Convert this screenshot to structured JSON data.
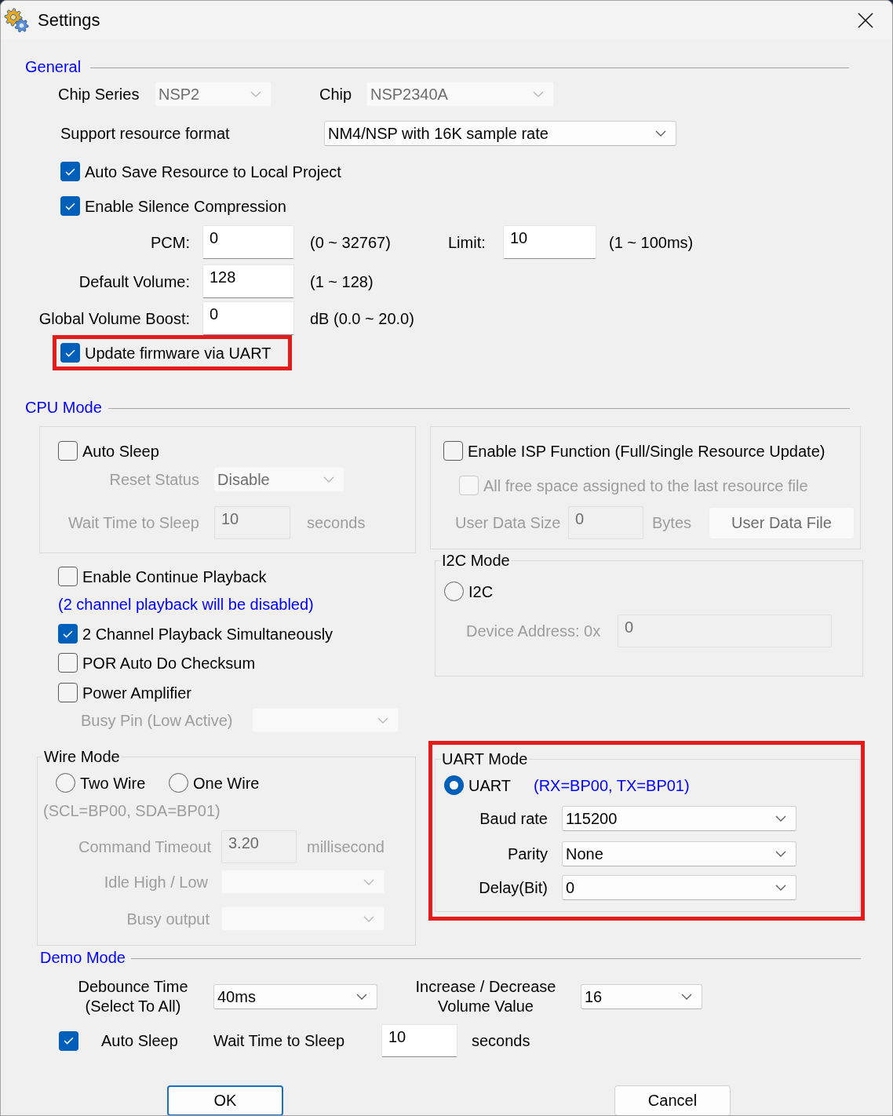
{
  "window": {
    "title": "Settings"
  },
  "general": {
    "heading": "General",
    "chip_series": {
      "label": "Chip Series",
      "value": "NSP2",
      "disabled": true
    },
    "chip": {
      "label": "Chip",
      "value": "NSP2340A",
      "disabled": true
    },
    "resource_format": {
      "label": "Support resource format",
      "value": "NM4/NSP with 16K sample rate",
      "disabled": false
    },
    "options": [
      {
        "label": "Auto Save Resource to Local Project",
        "checked": true
      },
      {
        "label": "Enable Silence Compression",
        "checked": true
      }
    ],
    "pcm": {
      "label": "PCM:",
      "value": "0",
      "range": "(0 ~ 32767)"
    },
    "limit": {
      "label": "Limit:",
      "value": "10",
      "range": "(1 ~ 100ms)"
    },
    "default_volume": {
      "label": "Default Volume:",
      "value": "128",
      "range": "(1 ~ 128)"
    },
    "global_volume_boost": {
      "label": "Global Volume Boost:",
      "value": "0",
      "range": "dB (0.0 ~ 20.0)"
    },
    "update_firmware": {
      "label": "Update firmware via UART",
      "checked": true,
      "highlighted": true
    }
  },
  "cpu_mode": {
    "heading": "CPU Mode",
    "sleep_group": {
      "auto_sleep": {
        "label": "Auto Sleep",
        "checked": false
      },
      "reset_status": {
        "label": "Reset Status",
        "value": "Disable",
        "disabled": true
      },
      "wait_time": {
        "label": "Wait Time to Sleep",
        "value": "10",
        "unit": "seconds",
        "disabled": true
      }
    },
    "playback_options": [
      {
        "kind": "checkbox",
        "label": "Enable Continue Playback",
        "checked": false
      },
      {
        "kind": "note",
        "text": "(2 channel playback will be disabled)"
      },
      {
        "kind": "checkbox",
        "label": "2 Channel Playback Simultaneously",
        "checked": true
      },
      {
        "kind": "checkbox",
        "label": "POR Auto Do Checksum",
        "checked": false
      },
      {
        "kind": "checkbox",
        "label": "Power Amplifier",
        "checked": false
      }
    ],
    "busy_pin": {
      "label": "Busy Pin (Low Active)",
      "disabled": true
    },
    "wire_mode": {
      "legend": "Wire Mode",
      "options": [
        {
          "label": "Two Wire",
          "selected": false
        },
        {
          "label": "One Wire",
          "selected": false
        }
      ],
      "pins": {
        "text": "(SCL=BP00, SDA=BP01)",
        "disabled": true
      },
      "command_timeout": {
        "label": "Command Timeout",
        "value": "3.20",
        "unit": "millisecond",
        "disabled": true
      },
      "idle_level": {
        "label": "Idle High / Low",
        "disabled": true
      },
      "busy_output": {
        "label": "Busy output",
        "disabled": true
      }
    },
    "isp_group": {
      "enable_isp": {
        "label": "Enable ISP Function (Full/Single Resource Update)",
        "checked": false
      },
      "all_free_space": {
        "label": "All free space assigned to the last resource file",
        "checked": false,
        "disabled": true
      },
      "user_data_size": {
        "label": "User Data Size",
        "value": "0",
        "unit": "Bytes",
        "disabled": true
      },
      "user_data_file": {
        "label": "User Data File",
        "disabled": true
      }
    },
    "i2c_mode": {
      "legend": "I2C Mode",
      "option": {
        "label": "I2C",
        "selected": false
      },
      "device_address": {
        "label": "Device Address: 0x",
        "value": "0",
        "disabled": true
      }
    },
    "uart_mode": {
      "legend": "UART Mode",
      "highlighted": true,
      "option": {
        "label": "UART",
        "selected": true
      },
      "pins": {
        "text": "(RX=BP00, TX=BP01)",
        "disabled": false
      },
      "settings": [
        {
          "label": "Baud rate",
          "value": "115200",
          "disabled": false
        },
        {
          "label": "Parity",
          "value": "None",
          "disabled": false
        },
        {
          "label": "Delay(Bit)",
          "value": "0",
          "disabled": false
        }
      ]
    }
  },
  "demo_mode": {
    "heading": "Demo Mode",
    "debounce": {
      "label": "Debounce Time\n(Select To All)",
      "value": "40ms"
    },
    "volume_step": {
      "label": "Increase / Decrease\nVolume Value",
      "value": "16"
    },
    "auto_sleep": {
      "label": "Auto Sleep",
      "checked": true
    },
    "wait_time": {
      "label": "Wait Time to Sleep",
      "value": "10",
      "unit": "seconds"
    }
  },
  "buttons": [
    {
      "label": "OK",
      "default": true
    },
    {
      "label": "Cancel",
      "default": false
    }
  ]
}
